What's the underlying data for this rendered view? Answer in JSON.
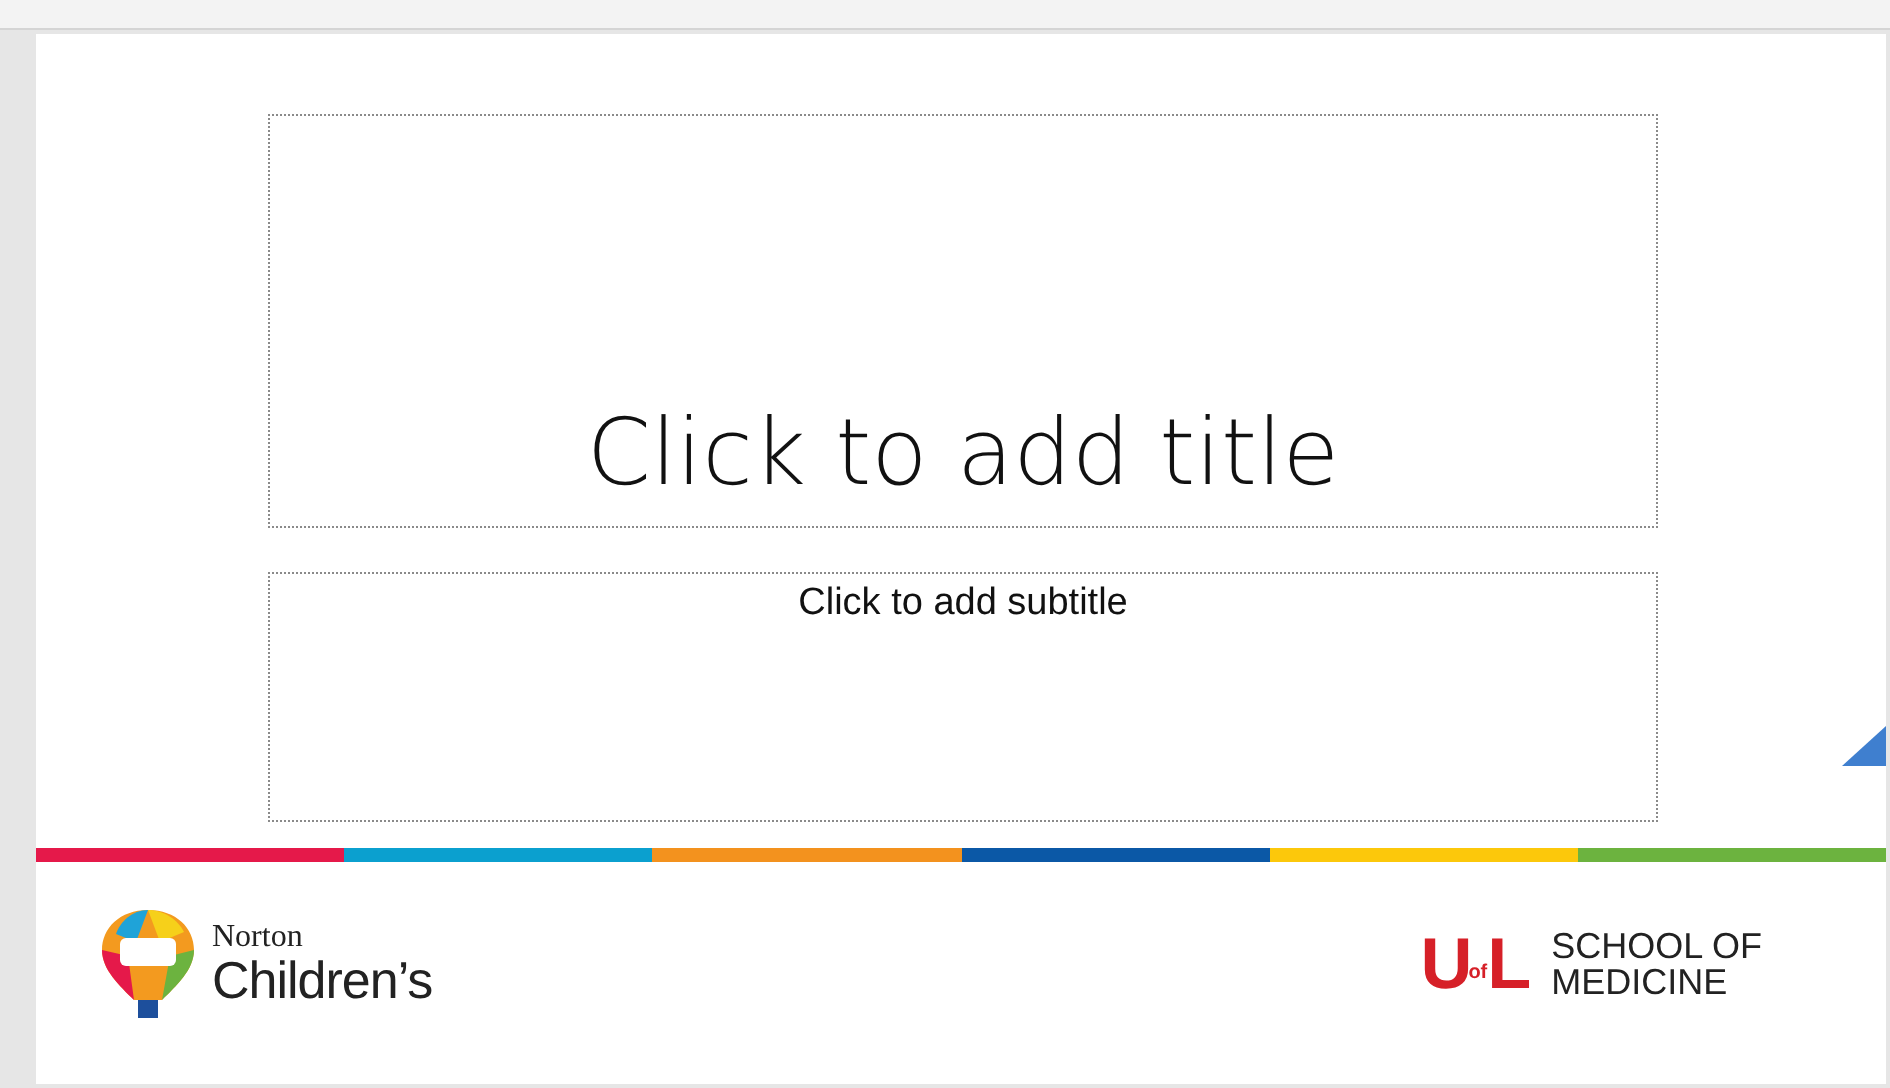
{
  "slide": {
    "title_placeholder": "Click to add title",
    "subtitle_placeholder": "Click to add subtitle",
    "stripe": [
      {
        "color": "#e5194a"
      },
      {
        "color": "#0ba0cf"
      },
      {
        "color": "#f3921e"
      },
      {
        "color": "#0b58a6"
      },
      {
        "color": "#fcc80b"
      },
      {
        "color": "#6cb33f"
      }
    ],
    "logos": {
      "left": {
        "line_1": "Norton",
        "line_2": "Children’s"
      },
      "right": {
        "mark_left": "U",
        "mark_middle": "of",
        "mark_right": "L",
        "line_1": "SCHOOL OF",
        "line_2": "MEDICINE"
      }
    }
  }
}
